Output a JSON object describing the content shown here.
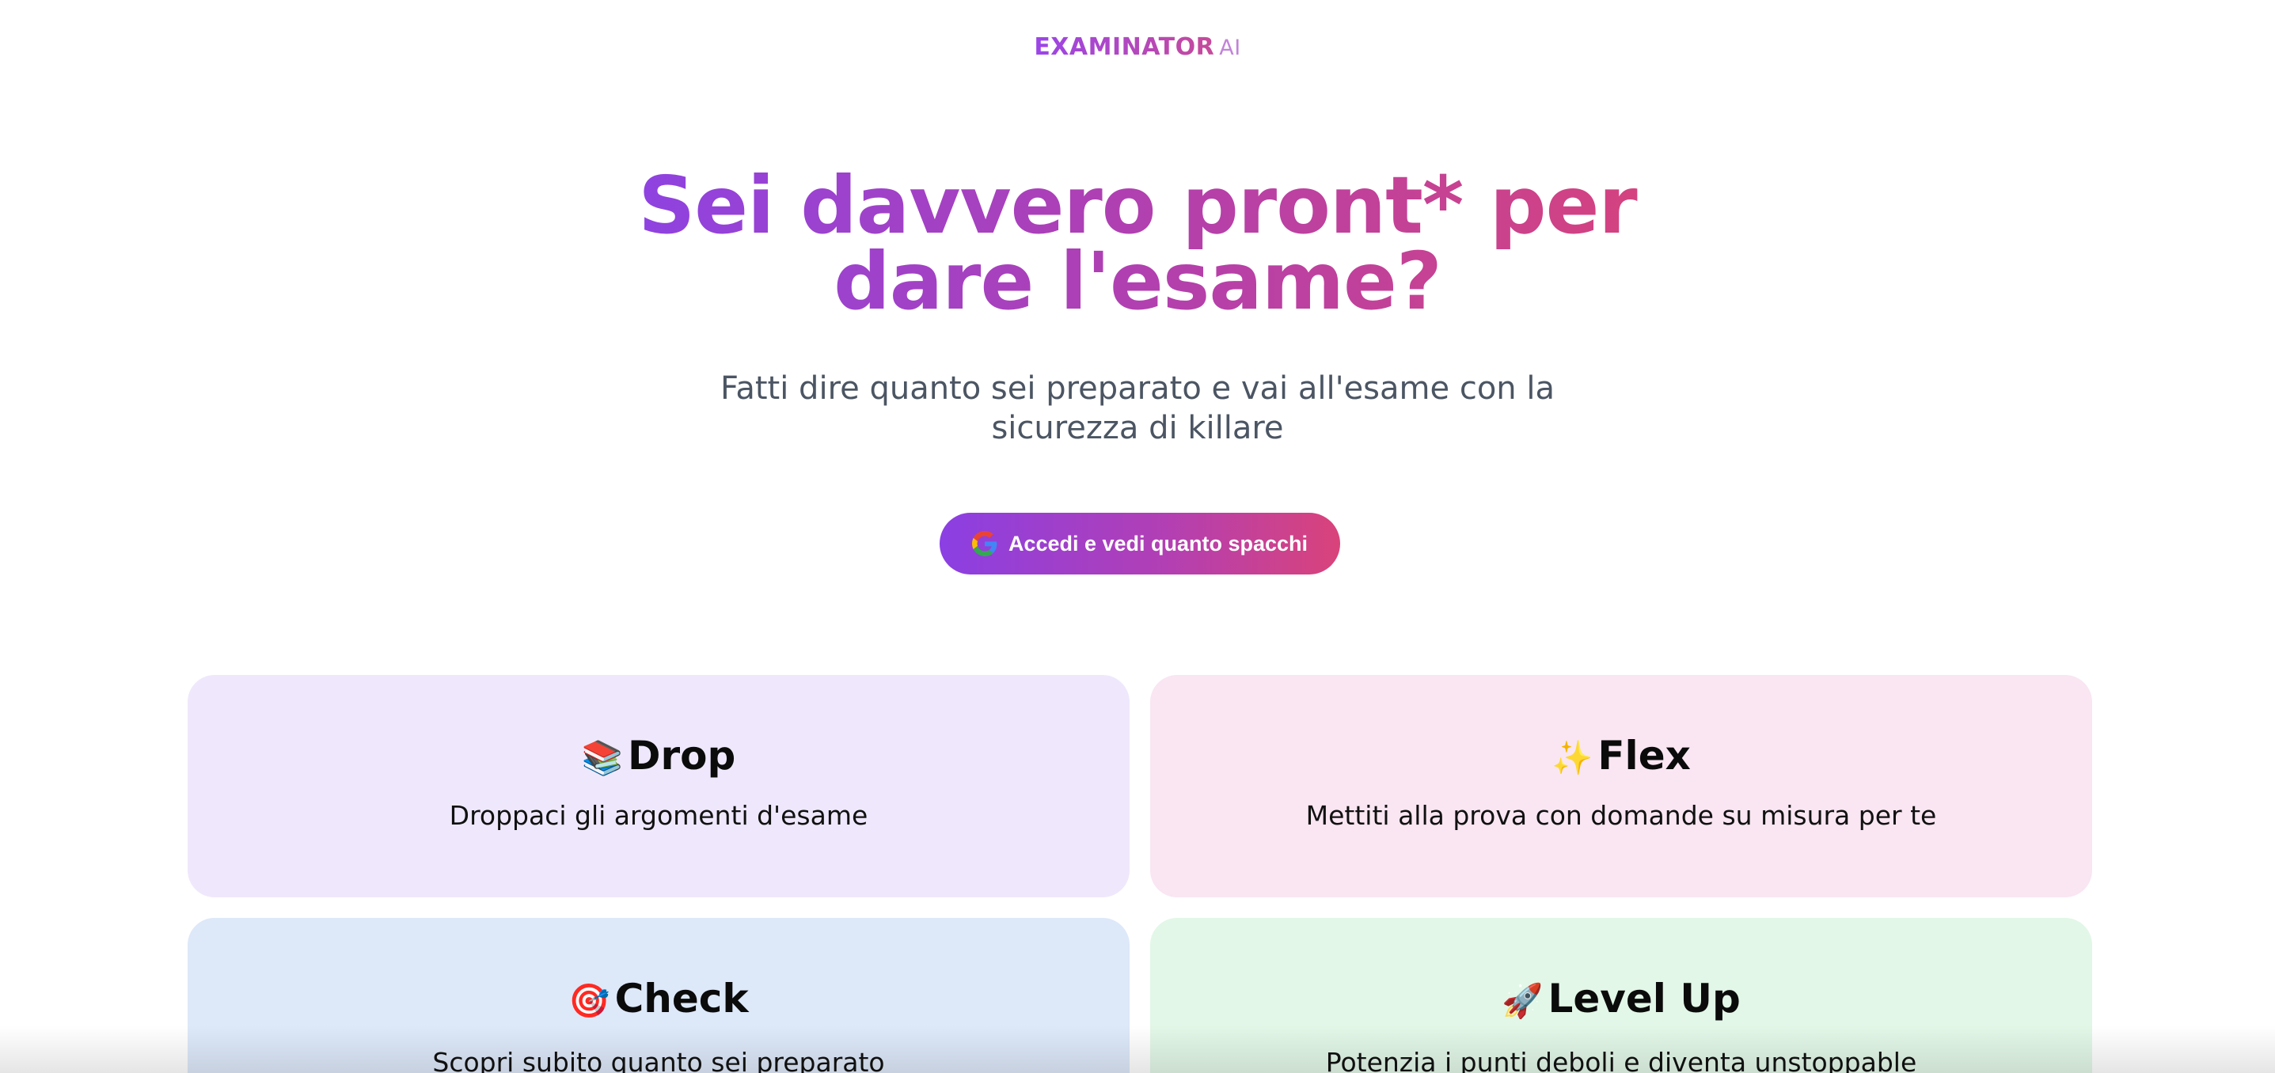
{
  "brand": {
    "name": "EXAMINATOR",
    "suffix": "AI"
  },
  "hero": {
    "title": "Sei davvero pront* per dare l'esame?",
    "subtitle": "Fatti dire quanto sei preparato e vai all'esame con la sicurezza di killare"
  },
  "cta": {
    "label": "Accedi e vedi quanto spacchi",
    "icon": "google-icon"
  },
  "features": [
    {
      "emoji": "📚",
      "title": "Drop",
      "description": "Droppaci gli argomenti d'esame"
    },
    {
      "emoji": "✨",
      "title": "Flex",
      "description": "Mettiti alla prova con domande su misura per te"
    },
    {
      "emoji": "🎯",
      "title": "Check",
      "description": "Scopri subito quanto sei preparato"
    },
    {
      "emoji": "🚀",
      "title": "Level Up",
      "description": "Potenzia i punti deboli e diventa unstoppable"
    }
  ],
  "colors": {
    "gradient_start": "#8b43e6",
    "gradient_end": "#d8437a",
    "card_purple": "#efe8fc",
    "card_pink": "#f9e6f2",
    "card_blue": "#dde8f9",
    "card_green": "#e2f7e7"
  }
}
